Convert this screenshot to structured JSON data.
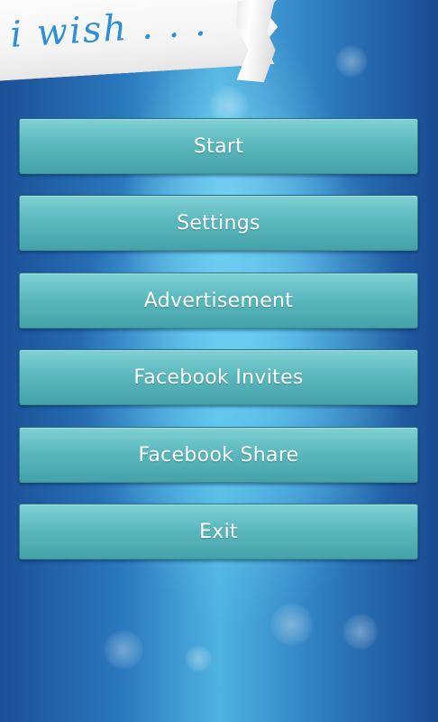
{
  "header": {
    "logo_text": "i wish . . ."
  },
  "menu": {
    "items": [
      {
        "label": "Start"
      },
      {
        "label": "Settings"
      },
      {
        "label": "Advertisement"
      },
      {
        "label": "Facebook Invites"
      },
      {
        "label": "Facebook Share"
      },
      {
        "label": "Exit"
      }
    ]
  },
  "colors": {
    "button_fill": "#5bb9be",
    "background_blue": "#2a78bd",
    "logo_blue": "#2e8fd6"
  }
}
